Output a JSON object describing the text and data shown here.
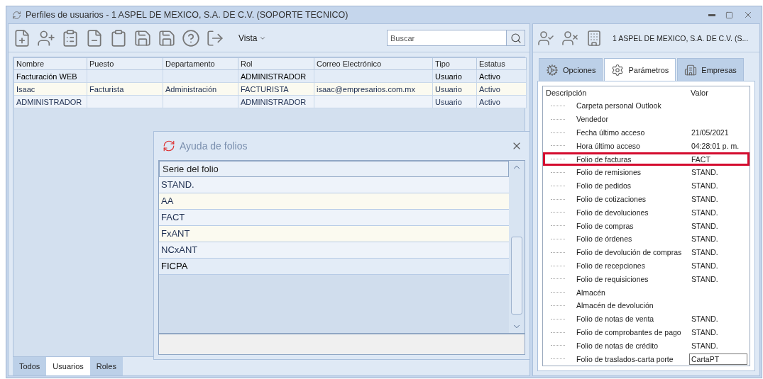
{
  "window": {
    "title": "Perfiles de usuarios - 1 ASPEL DE MEXICO, S.A. DE C.V. (SOPORTE TECNICO)"
  },
  "toolbar": {
    "menu": "Vista",
    "search": {
      "placeholder": "Buscar"
    }
  },
  "users_table": {
    "columns": [
      "Nombre",
      "Puesto",
      "Departamento",
      "Rol",
      "Correo Electrónico",
      "Tipo",
      "Estatus"
    ],
    "rows": [
      {
        "selected": true,
        "cells": [
          "Facturación WEB",
          "",
          "",
          "ADMINISTRADOR",
          "",
          "Usuario",
          "Activo"
        ]
      },
      {
        "selected": false,
        "cells": [
          "Isaac",
          "Facturista",
          "Administración",
          "FACTURISTA",
          "isaac@empresarios.com.mx",
          "Usuario",
          "Activo"
        ]
      },
      {
        "selected": false,
        "cells": [
          "ADMINISTRADOR",
          "",
          "",
          "ADMINISTRADOR",
          "",
          "Usuario",
          "Activo"
        ]
      }
    ]
  },
  "bottom_tabs": [
    {
      "label": "Todos",
      "selected": false
    },
    {
      "label": "Usuarios",
      "selected": true
    },
    {
      "label": "Roles",
      "selected": false
    }
  ],
  "folio_dialog": {
    "title": "Ayuda de folios",
    "column": "Serie del folio",
    "rows": [
      {
        "label": "STAND.",
        "selected": false
      },
      {
        "label": "AA",
        "selected": false
      },
      {
        "label": "FACT",
        "selected": false
      },
      {
        "label": "FxANT",
        "selected": false
      },
      {
        "label": "NCxANT",
        "selected": false
      },
      {
        "label": "FICPA",
        "selected": true
      }
    ]
  },
  "company": {
    "name": "1 ASPEL DE MEXICO, S.A. DE C.V. (S..."
  },
  "right_tabs": [
    {
      "label": "Opciones",
      "selected": false
    },
    {
      "label": "Parámetros",
      "selected": true
    },
    {
      "label": "Empresas",
      "selected": false
    }
  ],
  "parameters": {
    "columns": [
      "Descripción",
      "Valor"
    ],
    "rows": [
      {
        "description": "Carpeta personal Outlook",
        "value": "",
        "highlighted": false,
        "editing": false
      },
      {
        "description": "Vendedor",
        "value": "",
        "highlighted": false,
        "editing": false
      },
      {
        "description": "Fecha último acceso",
        "value": "21/05/2021",
        "highlighted": false,
        "editing": false
      },
      {
        "description": "Hora último acceso",
        "value": "04:28:01 p. m.",
        "highlighted": false,
        "editing": false
      },
      {
        "description": "Folio de facturas",
        "value": "FACT",
        "highlighted": true,
        "editing": false
      },
      {
        "description": "Folio de remisiones",
        "value": "STAND.",
        "highlighted": false,
        "editing": false
      },
      {
        "description": "Folio de pedidos",
        "value": "STAND.",
        "highlighted": false,
        "editing": false
      },
      {
        "description": "Folio de cotizaciones",
        "value": "STAND.",
        "highlighted": false,
        "editing": false
      },
      {
        "description": "Folio de devoluciones",
        "value": "STAND.",
        "highlighted": false,
        "editing": false
      },
      {
        "description": "Folio de compras",
        "value": "STAND.",
        "highlighted": false,
        "editing": false
      },
      {
        "description": "Folio de órdenes",
        "value": "STAND.",
        "highlighted": false,
        "editing": false
      },
      {
        "description": "Folio de devolución de compras",
        "value": "STAND.",
        "highlighted": false,
        "editing": false
      },
      {
        "description": "Folio de recepciones",
        "value": "STAND.",
        "highlighted": false,
        "editing": false
      },
      {
        "description": "Folio de requisiciones",
        "value": "STAND.",
        "highlighted": false,
        "editing": false
      },
      {
        "description": "Almacén",
        "value": "",
        "highlighted": false,
        "editing": false
      },
      {
        "description": "Almacén de devolución",
        "value": "",
        "highlighted": false,
        "editing": false
      },
      {
        "description": "Folio de notas de venta",
        "value": "STAND.",
        "highlighted": false,
        "editing": false
      },
      {
        "description": "Folio de comprobantes de pago",
        "value": "STAND.",
        "highlighted": false,
        "editing": false
      },
      {
        "description": "Folio de notas de crédito",
        "value": "STAND.",
        "highlighted": false,
        "editing": false
      },
      {
        "description": "Folio de traslados-carta porte",
        "value": "CartaPT",
        "highlighted": false,
        "editing": true
      }
    ]
  }
}
